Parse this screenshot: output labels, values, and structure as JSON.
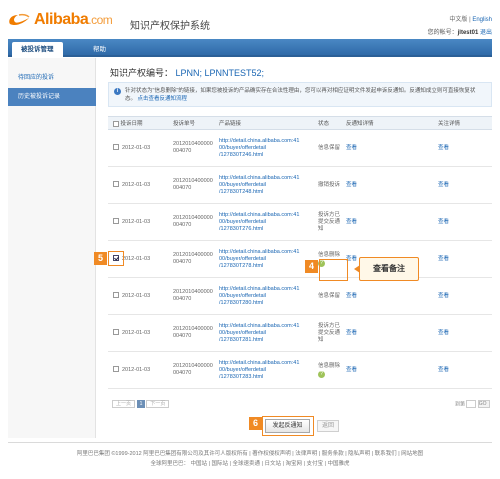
{
  "brand": {
    "name": "Alibaba",
    "suffix": ".com",
    "color": "#f07c00"
  },
  "header": {
    "system_title": "知识产权保护系统",
    "lang_current": "中文版",
    "lang_sep": " | ",
    "lang_other": "English",
    "account_label": "您的帐号：",
    "account_value": "jltest01",
    "logout": "退出"
  },
  "nav": {
    "tabs": [
      {
        "label": "被投诉管理"
      },
      {
        "label": "帮助"
      }
    ]
  },
  "sidebar": {
    "items": [
      {
        "label": "待回应的投诉"
      },
      {
        "label": "历史被投诉记录"
      }
    ]
  },
  "ip": {
    "label": "知识产权编号：",
    "value": "LPNN; LPNNTEST52;"
  },
  "notice": {
    "icon": "i",
    "text": "针对状态为\"信息删除\"的链接，如果您被投诉的产品确实存在合法性理由，您可以再对相应证明文件发起申诉反通知。反通知成立则可直接恢复状态。",
    "link": "点击查看反通知流程"
  },
  "table": {
    "headers": [
      "投诉日期",
      "投诉单号",
      "产品链接",
      "状态",
      "反通知详情",
      "关注详情"
    ],
    "rows": [
      {
        "date": "2012-01-03",
        "id1": "2012010400000",
        "id2": "004070",
        "url1": "http://detail.china.alibaba.com:41",
        "url2": "00/buyer/offerdetail",
        "url3": "/127830T246.html",
        "status1": "信息保留",
        "status2": "",
        "note": "",
        "counter": "查看",
        "detail": "查看"
      },
      {
        "date": "2012-01-03",
        "id1": "2012010400000",
        "id2": "004070",
        "url1": "http://detail.china.alibaba.com:41",
        "url2": "00/buyer/offerdetail",
        "url3": "/127830T248.html",
        "status1": "撤销投诉",
        "status2": "",
        "note": "",
        "counter": "查看",
        "detail": "查看"
      },
      {
        "date": "2012-01-03",
        "id1": "2012010400000",
        "id2": "004070",
        "url1": "http://detail.china.alibaba.com:41",
        "url2": "00/buyer/offerdetail",
        "url3": "/127830T276.html",
        "status1": "投诉方已",
        "status2": "提交反通",
        "status3": "知",
        "note": "",
        "counter": "查看",
        "detail": "查看"
      },
      {
        "date": "2012-01-03",
        "id1": "2012010400000",
        "id2": "004070",
        "url1": "http://detail.china.alibaba.com:41",
        "url2": "00/buyer/offerdetail",
        "url3": "/127830T278.html",
        "status1": "信息删除",
        "status2": "",
        "note": "?",
        "counter": "查看",
        "detail": "查看",
        "checked": true
      },
      {
        "date": "2012-01-03",
        "id1": "2012010400000",
        "id2": "004070",
        "url1": "http://detail.china.alibaba.com:41",
        "url2": "00/buyer/offerdetail",
        "url3": "/127830T280.html",
        "status1": "信息保留",
        "status2": "",
        "note": "",
        "counter": "查看",
        "detail": "查看"
      },
      {
        "date": "2012-01-03",
        "id1": "2012010400000",
        "id2": "004070",
        "url1": "http://detail.china.alibaba.com:41",
        "url2": "00/buyer/offerdetail",
        "url3": "/127830T281.html",
        "status1": "投诉方已",
        "status2": "提交反通",
        "status3": "知",
        "note": "",
        "counter": "查看",
        "detail": "查看"
      },
      {
        "date": "2012-01-03",
        "id1": "2012010400000",
        "id2": "004070",
        "url1": "http://detail.china.alibaba.com:41",
        "url2": "00/buyer/offerdetail",
        "url3": "/127830T283.html",
        "status1": "信息删除",
        "status2": "",
        "note": "?",
        "counter": "查看",
        "detail": "查看"
      }
    ]
  },
  "callouts": {
    "c4": "4",
    "c5": "5",
    "c6": "6",
    "tip": "查看备注"
  },
  "pager": {
    "prev": "上一页",
    "current": "1",
    "next": "下一页",
    "goto_label": "到第",
    "go": "GO"
  },
  "actions": {
    "submit": "发起反通知",
    "cancel": "返回"
  },
  "footer": {
    "line1": "阿里巴巴集团 ©1999-2012 阿里巴巴集团有限公司及其许可人版权所有 | 著作权侵权声明 | 法律声明 | 服务条款 | 隐私声明 | 联系我们 | 网站地图",
    "line2": "全球阿里巴巴： 中国站 | 国际站 | 全球速卖通 | 日文站 | 淘宝网 | 支付宝 | 中国雅虎"
  }
}
